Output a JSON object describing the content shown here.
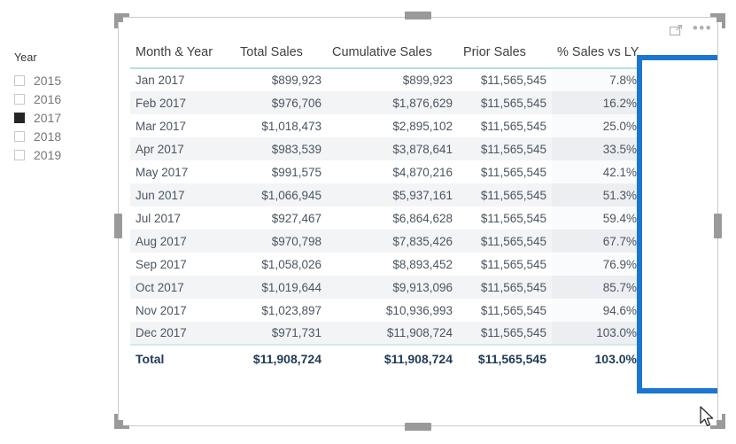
{
  "slicer": {
    "title": "Year",
    "items": [
      {
        "label": "2015",
        "checked": false
      },
      {
        "label": "2016",
        "checked": false
      },
      {
        "label": "2017",
        "checked": true
      },
      {
        "label": "2018",
        "checked": false
      },
      {
        "label": "2019",
        "checked": false
      }
    ]
  },
  "visual": {
    "focus_icon": "focus-mode-icon",
    "more_icon": "•••",
    "highlight_color": "#1b76d1",
    "header_underline_color": "#b7dfe0"
  },
  "table": {
    "columns": [
      "Month & Year",
      "Total Sales",
      "Cumulative Sales",
      "Prior Sales",
      "% Sales vs LY"
    ],
    "rows": [
      {
        "month": "Jan 2017",
        "total_sales": "$899,923",
        "cumulative_sales": "$899,923",
        "prior_sales": "$11,565,545",
        "pct_sales_vs_ly": "7.8%"
      },
      {
        "month": "Feb 2017",
        "total_sales": "$976,706",
        "cumulative_sales": "$1,876,629",
        "prior_sales": "$11,565,545",
        "pct_sales_vs_ly": "16.2%"
      },
      {
        "month": "Mar 2017",
        "total_sales": "$1,018,473",
        "cumulative_sales": "$2,895,102",
        "prior_sales": "$11,565,545",
        "pct_sales_vs_ly": "25.0%"
      },
      {
        "month": "Apr 2017",
        "total_sales": "$983,539",
        "cumulative_sales": "$3,878,641",
        "prior_sales": "$11,565,545",
        "pct_sales_vs_ly": "33.5%"
      },
      {
        "month": "May 2017",
        "total_sales": "$991,575",
        "cumulative_sales": "$4,870,216",
        "prior_sales": "$11,565,545",
        "pct_sales_vs_ly": "42.1%"
      },
      {
        "month": "Jun 2017",
        "total_sales": "$1,066,945",
        "cumulative_sales": "$5,937,161",
        "prior_sales": "$11,565,545",
        "pct_sales_vs_ly": "51.3%"
      },
      {
        "month": "Jul 2017",
        "total_sales": "$927,467",
        "cumulative_sales": "$6,864,628",
        "prior_sales": "$11,565,545",
        "pct_sales_vs_ly": "59.4%"
      },
      {
        "month": "Aug 2017",
        "total_sales": "$970,798",
        "cumulative_sales": "$7,835,426",
        "prior_sales": "$11,565,545",
        "pct_sales_vs_ly": "67.7%"
      },
      {
        "month": "Sep 2017",
        "total_sales": "$1,058,026",
        "cumulative_sales": "$8,893,452",
        "prior_sales": "$11,565,545",
        "pct_sales_vs_ly": "76.9%"
      },
      {
        "month": "Oct 2017",
        "total_sales": "$1,019,644",
        "cumulative_sales": "$9,913,096",
        "prior_sales": "$11,565,545",
        "pct_sales_vs_ly": "85.7%"
      },
      {
        "month": "Nov 2017",
        "total_sales": "$1,023,897",
        "cumulative_sales": "$10,936,993",
        "prior_sales": "$11,565,545",
        "pct_sales_vs_ly": "94.6%"
      },
      {
        "month": "Dec 2017",
        "total_sales": "$971,731",
        "cumulative_sales": "$11,908,724",
        "prior_sales": "$11,565,545",
        "pct_sales_vs_ly": "103.0%"
      }
    ],
    "total_row": {
      "month": "Total",
      "total_sales": "$11,908,724",
      "cumulative_sales": "$11,908,724",
      "prior_sales": "$11,565,545",
      "pct_sales_vs_ly": "103.0%"
    }
  },
  "chart_data": {
    "type": "table",
    "title": "",
    "columns": [
      "Month & Year",
      "Total Sales",
      "Cumulative Sales",
      "Prior Sales",
      "% Sales vs LY"
    ],
    "categories": [
      "Jan 2017",
      "Feb 2017",
      "Mar 2017",
      "Apr 2017",
      "May 2017",
      "Jun 2017",
      "Jul 2017",
      "Aug 2017",
      "Sep 2017",
      "Oct 2017",
      "Nov 2017",
      "Dec 2017"
    ],
    "series": [
      {
        "name": "Total Sales",
        "values": [
          899923,
          976706,
          1018473,
          983539,
          991575,
          1066945,
          927467,
          970798,
          1058026,
          1019644,
          1023897,
          971731
        ]
      },
      {
        "name": "Cumulative Sales",
        "values": [
          899923,
          1876629,
          2895102,
          3878641,
          4870216,
          5937161,
          6864628,
          7835426,
          8893452,
          9913096,
          10936993,
          11908724
        ]
      },
      {
        "name": "Prior Sales",
        "values": [
          11565545,
          11565545,
          11565545,
          11565545,
          11565545,
          11565545,
          11565545,
          11565545,
          11565545,
          11565545,
          11565545,
          11565545
        ]
      },
      {
        "name": "% Sales vs LY",
        "values": [
          7.8,
          16.2,
          25.0,
          33.5,
          42.1,
          51.3,
          59.4,
          67.7,
          76.9,
          85.7,
          94.6,
          103.0
        ]
      }
    ],
    "totals": {
      "Total Sales": 11908724,
      "Cumulative Sales": 11908724,
      "Prior Sales": 11565545,
      "% Sales vs LY": 103.0
    },
    "highlighted_column": "% Sales vs LY"
  }
}
